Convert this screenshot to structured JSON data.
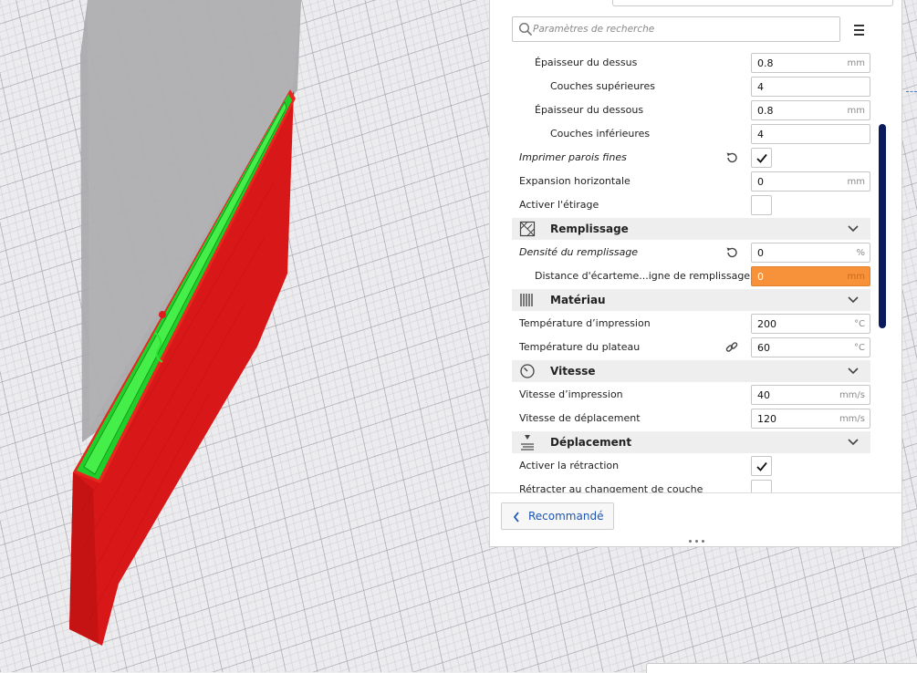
{
  "search": {
    "placeholder": "Paramètres de recherche",
    "icon": "search-icon"
  },
  "menu": {
    "icon": "hamburger-menu-icon"
  },
  "settings": [
    {
      "kind": "field",
      "label": "Épaisseur du dessus",
      "value": "0.8",
      "unit": "mm",
      "indent": 1
    },
    {
      "kind": "field",
      "label": "Couches supérieures",
      "value": "4",
      "unit": "",
      "indent": 2
    },
    {
      "kind": "field",
      "label": "Épaisseur du dessous",
      "value": "0.8",
      "unit": "mm",
      "indent": 1
    },
    {
      "kind": "field",
      "label": "Couches inférieures",
      "value": "4",
      "unit": "",
      "indent": 2
    },
    {
      "kind": "check",
      "label": "Imprimer parois fines",
      "checked": true,
      "italic": true,
      "reset": true
    },
    {
      "kind": "field",
      "label": "Expansion horizontale",
      "value": "0",
      "unit": "mm"
    },
    {
      "kind": "check",
      "label": "Activer l'étirage",
      "checked": false
    },
    {
      "kind": "category",
      "label": "Remplissage",
      "icon": "infill-icon"
    },
    {
      "kind": "field",
      "label": "Densité du remplissage",
      "value": "0",
      "unit": "%",
      "italic": true,
      "reset": true
    },
    {
      "kind": "field",
      "label": "Distance d'écarteme...igne de remplissage",
      "value": "0",
      "unit": "mm",
      "indent": 1,
      "warning": true
    },
    {
      "kind": "category",
      "label": "Matériau",
      "icon": "material-icon"
    },
    {
      "kind": "field",
      "label": "Température d’impression",
      "value": "200",
      "unit": "°C"
    },
    {
      "kind": "field",
      "label": "Température du plateau",
      "value": "60",
      "unit": "°C",
      "linked": true
    },
    {
      "kind": "category",
      "label": "Vitesse",
      "icon": "speed-gauge-icon"
    },
    {
      "kind": "field",
      "label": "Vitesse d’impression",
      "value": "40",
      "unit": "mm/s"
    },
    {
      "kind": "field",
      "label": "Vitesse de déplacement",
      "value": "120",
      "unit": "mm/s"
    },
    {
      "kind": "category",
      "label": "Déplacement",
      "icon": "travel-icon"
    },
    {
      "kind": "check",
      "label": "Activer la rétraction",
      "checked": true
    },
    {
      "kind": "check",
      "label": "Rétracter au changement de couche",
      "checked": false
    }
  ],
  "footer": {
    "recommended_label": "Recommandé"
  },
  "colors": {
    "warning": "#f7923a",
    "accent": "#1d55b5",
    "scrollbar": "#0b1a5c",
    "model_red": "#e01b1b",
    "model_green": "#22dd22"
  }
}
